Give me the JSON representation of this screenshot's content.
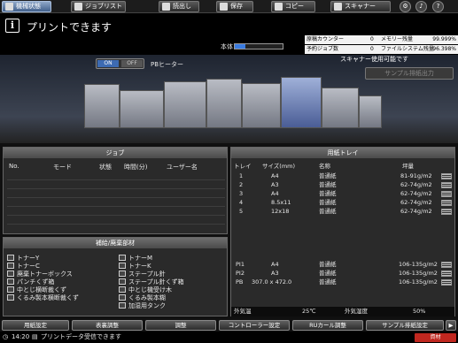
{
  "tabs": [
    {
      "label": "機械状態",
      "active": true
    },
    {
      "label": "ジョブリスト",
      "active": false
    },
    {
      "label": "読出し",
      "active": false
    },
    {
      "label": "保存",
      "active": false
    },
    {
      "label": "コピー",
      "active": false
    },
    {
      "label": "スキャナー",
      "active": false
    }
  ],
  "status": {
    "message": "プリントできます",
    "body_label": "本体",
    "body_progress": 0.22
  },
  "counters": {
    "rows": [
      {
        "label": "原稿カウンター",
        "value": "0",
        "label2": "メモリー残量",
        "value2": "99.999%"
      },
      {
        "label": "予約ジョブ数",
        "value": "0",
        "label2": "ファイルシステム残量",
        "value2": "96.398%"
      }
    ]
  },
  "machine": {
    "on_label": "ON",
    "off_label": "OFF",
    "pb_heater": "PBヒーター",
    "scanner_status": "スキャナー使用可能です",
    "sample_button": "サンプル排紙出力"
  },
  "job_panel": {
    "title": "ジョブ",
    "headers": [
      "No.",
      "モード",
      "状態",
      "時間(分)",
      "ユーザー名"
    ]
  },
  "supply_panel": {
    "title": "補給/廃棄部材",
    "left_items": [
      "トナーY",
      "トナーC",
      "廃棄トナーボックス",
      "パンチくず箱",
      "中とじ横断裁くず",
      "くるみ製本横断裁くず"
    ],
    "right_items": [
      "トナーM",
      "トナーK",
      "ステープル針",
      "ステープル針くず箱",
      "中とじ機受け木",
      "くるみ製本糊",
      "加湿用タンク"
    ]
  },
  "tray_panel": {
    "title": "用紙トレイ",
    "headers": [
      "トレイ",
      "サイズ(mm)",
      "名称",
      "坪量"
    ],
    "rows": [
      {
        "tray": "1",
        "size": "A4",
        "name": "普通紙",
        "weight": "81-91g/m2"
      },
      {
        "tray": "2",
        "size": "A3",
        "name": "普通紙",
        "weight": "62-74g/m2"
      },
      {
        "tray": "3",
        "size": "A4",
        "name": "普通紙",
        "weight": "62-74g/m2"
      },
      {
        "tray": "4",
        "size": "8.5x11",
        "name": "普通紙",
        "weight": "62-74g/m2"
      },
      {
        "tray": "5",
        "size": "12x18",
        "name": "普通紙",
        "weight": "62-74g/m2"
      },
      {
        "tray": "PI1",
        "size": "A4",
        "name": "普通紙",
        "weight": "106-135g/m2"
      },
      {
        "tray": "PI2",
        "size": "A3",
        "name": "普通紙",
        "weight": "106-135g/m2"
      },
      {
        "tray": "PB",
        "size": "307.0 x 472.0",
        "name": "普通紙",
        "weight": "106-135g/m2"
      }
    ],
    "outside_temp_label": "外気温",
    "outside_temp_value": "25℃",
    "outside_humidity_label": "外気湿度",
    "outside_humidity_value": "50%"
  },
  "function_buttons": [
    "用紙設定",
    "表裏調整",
    "調整",
    "コントローラー設定",
    "RUカール調整",
    "サンプル排紙設定"
  ],
  "footer": {
    "time": "14:20",
    "message": "プリントデータ受信できます",
    "alarm": "資材"
  },
  "colors": {
    "accent": "#3a7be0",
    "active_tab": "#6f8bb3",
    "alarm": "#c0271f"
  }
}
